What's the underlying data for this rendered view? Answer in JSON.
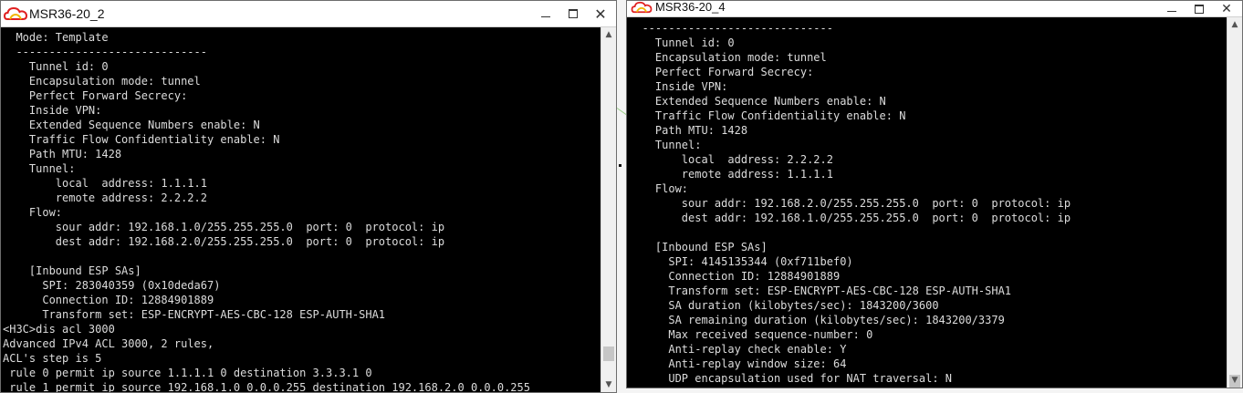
{
  "windows": [
    {
      "title": "MSR36-20_2",
      "lines": [
        "  Mode: Template",
        "  -----------------------------",
        "    Tunnel id: 0",
        "    Encapsulation mode: tunnel",
        "    Perfect Forward Secrecy:",
        "    Inside VPN:",
        "    Extended Sequence Numbers enable: N",
        "    Traffic Flow Confidentiality enable: N",
        "    Path MTU: 1428",
        "    Tunnel:",
        "        local  address: 1.1.1.1",
        "        remote address: 2.2.2.2",
        "    Flow:",
        "        sour addr: 192.168.1.0/255.255.255.0  port: 0  protocol: ip",
        "        dest addr: 192.168.2.0/255.255.255.0  port: 0  protocol: ip",
        "",
        "    [Inbound ESP SAs]",
        "      SPI: 283040359 (0x10deda67)",
        "      Connection ID: 12884901889",
        "      Transform set: ESP-ENCRYPT-AES-CBC-128 ESP-AUTH-SHA1",
        "<H3C>dis acl 3000",
        "Advanced IPv4 ACL 3000, 2 rules,",
        "ACL's step is 5",
        " rule 0 permit ip source 1.1.1.1 0 destination 3.3.3.1 0",
        " rule 1 permit ip source 192.168.1.0 0.0.0.255 destination 192.168.2.0 0.0.0.255"
      ]
    },
    {
      "title": "MSR36-20_4",
      "lines": [
        "  -----------------------------",
        "    Tunnel id: 0",
        "    Encapsulation mode: tunnel",
        "    Perfect Forward Secrecy:",
        "    Inside VPN:",
        "    Extended Sequence Numbers enable: N",
        "    Traffic Flow Confidentiality enable: N",
        "    Path MTU: 1428",
        "    Tunnel:",
        "        local  address: 2.2.2.2",
        "        remote address: 1.1.1.1",
        "    Flow:",
        "        sour addr: 192.168.2.0/255.255.255.0  port: 0  protocol: ip",
        "        dest addr: 192.168.1.0/255.255.255.0  port: 0  protocol: ip",
        "",
        "    [Inbound ESP SAs]",
        "      SPI: 4145135344 (0xf711bef0)",
        "      Connection ID: 12884901889",
        "      Transform set: ESP-ENCRYPT-AES-CBC-128 ESP-AUTH-SHA1",
        "      SA duration (kilobytes/sec): 1843200/3600",
        "      SA remaining duration (kilobytes/sec): 1843200/3379",
        "      Max received sequence-number: 0",
        "      Anti-replay check enable: Y",
        "      Anti-replay window size: 64",
        "      UDP encapsulation used for NAT traversal: N"
      ]
    }
  ],
  "icons": {
    "app": "cloud-app-icon",
    "minimize": "minimize-icon",
    "maximize": "maximize-icon",
    "close": "close-icon"
  },
  "colors": {
    "terminal_bg": "#000000",
    "terminal_text": "#dcdcdc",
    "titlebar_bg": "#ffffff",
    "icon_red": "#e02020",
    "icon_yellow": "#f2b705"
  }
}
